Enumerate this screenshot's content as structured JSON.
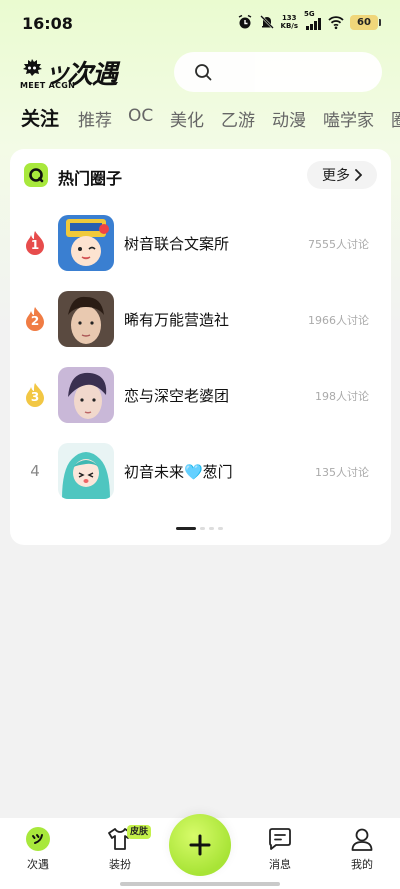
{
  "status_bar": {
    "time": "16:08",
    "net_speed_value": "133",
    "net_speed_unit": "KB/s",
    "network": "5G",
    "battery": "60"
  },
  "header": {
    "logo_text": "次遇",
    "logo_sub": "MEET ACGN"
  },
  "tabs": [
    {
      "label": "关注",
      "active": true
    },
    {
      "label": "推荐"
    },
    {
      "label": "OC"
    },
    {
      "label": "美化"
    },
    {
      "label": "乙游"
    },
    {
      "label": "动漫"
    },
    {
      "label": "嗑学家"
    },
    {
      "label": "圈"
    }
  ],
  "hot_circles": {
    "title": "热门圈子",
    "more_label": "更多",
    "items": [
      {
        "rank": "1",
        "name": "树音联合文案所",
        "count": "7555人讨论"
      },
      {
        "rank": "2",
        "name": "晞有万能营造社",
        "count": "1966人讨论"
      },
      {
        "rank": "3",
        "name": "恋与深空老婆团",
        "count": "198人讨论"
      },
      {
        "rank": "4",
        "name": "初音未来🩵葱门",
        "count": "135人讨论"
      }
    ],
    "page_count": 4,
    "active_page": 1
  },
  "bottom_nav": {
    "items": [
      {
        "label": "次遇",
        "icon": "home-logo-icon",
        "active": true
      },
      {
        "label": "装扮",
        "icon": "shirt-icon",
        "badge": "皮肤"
      },
      {
        "label": "",
        "icon": "plus-icon"
      },
      {
        "label": "消息",
        "icon": "message-icon"
      },
      {
        "label": "我的",
        "icon": "profile-icon"
      }
    ]
  },
  "colors": {
    "accent": "#a8e83c",
    "rank1": "#e74c4c",
    "rank2": "#f07c44",
    "rank3": "#f2c744"
  }
}
